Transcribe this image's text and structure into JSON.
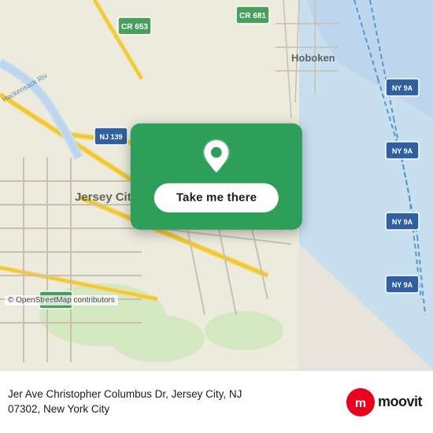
{
  "map": {
    "center_lat": 40.718,
    "center_lon": -74.043,
    "alt_text": "Map of Jersey City, NJ area"
  },
  "action_card": {
    "button_label": "Take me there"
  },
  "bottom_bar": {
    "address_line1": "Jer Ave Christopher Columbus Dr, Jersey City, NJ",
    "address_line2": "07302, New York City"
  },
  "attribution": {
    "text": "© OpenStreetMap contributors"
  },
  "moovit": {
    "logo_text": "moovit"
  }
}
